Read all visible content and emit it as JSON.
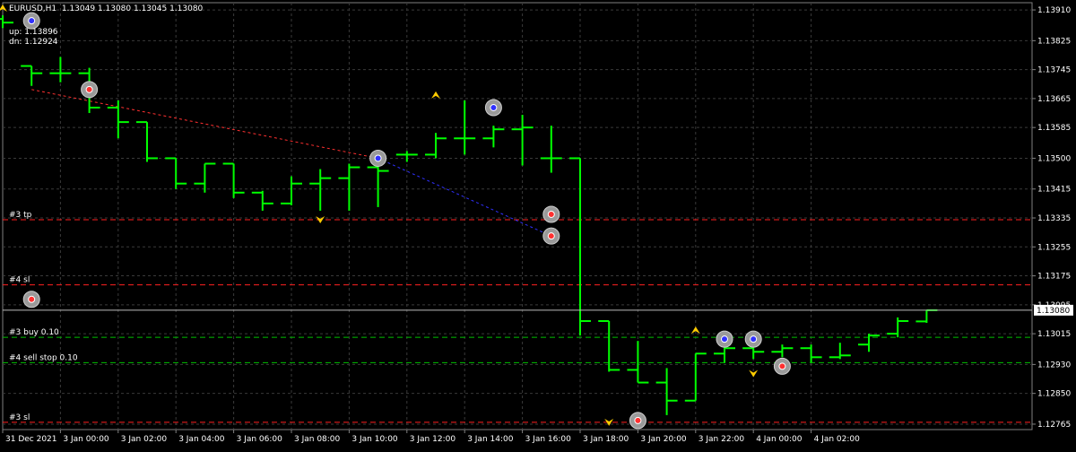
{
  "header": {
    "title": "EURUSD,H1  1.13049 1.13080 1.13045 1.13080",
    "up_label": "up: 1.13896",
    "dn_label": "dn: 1.12924"
  },
  "colors": {
    "background": "#000000",
    "grid": "#3a3a3a",
    "bar": "#00ff00",
    "axis_text": "#ffffff",
    "level_red": "#ff2020",
    "level_green": "#00c000",
    "trade_red": "#ff3030",
    "trade_blue": "#3030ff",
    "arrow_yellow": "#ffcc00"
  },
  "price_ticks": [
    "1.13910",
    "1.13825",
    "1.13745",
    "1.13665",
    "1.13585",
    "1.13500",
    "1.13415",
    "1.13335",
    "1.13255",
    "1.13175",
    "1.13095",
    "1.13015",
    "1.12930",
    "1.12850",
    "1.12765"
  ],
  "current_price_label": "1.13080",
  "time_ticks": [
    "31 Dec 2021",
    "3 Jan 00:00",
    "3 Jan 02:00",
    "3 Jan 04:00",
    "3 Jan 06:00",
    "3 Jan 08:00",
    "3 Jan 10:00",
    "3 Jan 12:00",
    "3 Jan 14:00",
    "3 Jan 16:00",
    "3 Jan 18:00",
    "3 Jan 20:00",
    "3 Jan 22:00",
    "4 Jan 00:00",
    "4 Jan 02:00"
  ],
  "levels": [
    {
      "label": "#3 tp",
      "price": 1.1333,
      "kind": "red"
    },
    {
      "label": "#4 sl",
      "price": 1.1315,
      "kind": "red"
    },
    {
      "label": "#3 buy 0.10",
      "price": 1.13005,
      "kind": "green"
    },
    {
      "label": "#4 sell stop 0.10",
      "price": 1.12935,
      "kind": "green"
    },
    {
      "label": "#3 sl",
      "price": 1.1277,
      "kind": "red"
    }
  ],
  "chart_data": {
    "type": "ohlc",
    "price_range": [
      1.1275,
      1.1393
    ],
    "grid": true,
    "bars": [
      {
        "o": 1.13885,
        "h": 1.13895,
        "l": 1.1386,
        "c": 1.13875
      },
      {
        "o": 1.13755,
        "h": 1.13755,
        "l": 1.137,
        "c": 1.13735
      },
      {
        "o": 1.13735,
        "h": 1.1378,
        "l": 1.1371,
        "c": 1.13735
      },
      {
        "o": 1.13735,
        "h": 1.1375,
        "l": 1.13625,
        "c": 1.1364
      },
      {
        "o": 1.1364,
        "h": 1.1366,
        "l": 1.13555,
        "c": 1.136
      },
      {
        "o": 1.136,
        "h": 1.136,
        "l": 1.1349,
        "c": 1.135
      },
      {
        "o": 1.135,
        "h": 1.135,
        "l": 1.13415,
        "c": 1.1343
      },
      {
        "o": 1.1343,
        "h": 1.13485,
        "l": 1.13405,
        "c": 1.13485
      },
      {
        "o": 1.13485,
        "h": 1.13485,
        "l": 1.1339,
        "c": 1.13405
      },
      {
        "o": 1.13405,
        "h": 1.1341,
        "l": 1.13355,
        "c": 1.13375
      },
      {
        "o": 1.13375,
        "h": 1.1345,
        "l": 1.1337,
        "c": 1.1343
      },
      {
        "o": 1.1343,
        "h": 1.1347,
        "l": 1.13355,
        "c": 1.13445
      },
      {
        "o": 1.13445,
        "h": 1.13485,
        "l": 1.13355,
        "c": 1.13475
      },
      {
        "o": 1.13475,
        "h": 1.1349,
        "l": 1.13365,
        "c": 1.13465
      },
      {
        "o": 1.1351,
        "h": 1.1352,
        "l": 1.1349,
        "c": 1.1351
      },
      {
        "o": 1.1351,
        "h": 1.1357,
        "l": 1.135,
        "c": 1.13555
      },
      {
        "o": 1.13555,
        "h": 1.1366,
        "l": 1.1351,
        "c": 1.13555
      },
      {
        "o": 1.13555,
        "h": 1.1359,
        "l": 1.1353,
        "c": 1.1358
      },
      {
        "o": 1.1358,
        "h": 1.1362,
        "l": 1.1348,
        "c": 1.13585
      },
      {
        "o": 1.135,
        "h": 1.1359,
        "l": 1.1346,
        "c": 1.135
      },
      {
        "o": 1.135,
        "h": 1.135,
        "l": 1.1301,
        "c": 1.1305
      },
      {
        "o": 1.1305,
        "h": 1.1305,
        "l": 1.1291,
        "c": 1.12915
      },
      {
        "o": 1.12915,
        "h": 1.12995,
        "l": 1.1288,
        "c": 1.1288
      },
      {
        "o": 1.1288,
        "h": 1.1292,
        "l": 1.1279,
        "c": 1.1283
      },
      {
        "o": 1.1283,
        "h": 1.1296,
        "l": 1.1283,
        "c": 1.1296
      },
      {
        "o": 1.1296,
        "h": 1.12985,
        "l": 1.12935,
        "c": 1.12975
      },
      {
        "o": 1.12975,
        "h": 1.12995,
        "l": 1.12945,
        "c": 1.12965
      },
      {
        "o": 1.12965,
        "h": 1.12985,
        "l": 1.1295,
        "c": 1.12975
      },
      {
        "o": 1.12975,
        "h": 1.12985,
        "l": 1.12935,
        "c": 1.1295
      },
      {
        "o": 1.1295,
        "h": 1.1299,
        "l": 1.12945,
        "c": 1.12955
      },
      {
        "o": 1.12985,
        "h": 1.13015,
        "l": 1.12965,
        "c": 1.1301
      },
      {
        "o": 1.13015,
        "h": 1.1306,
        "l": 1.13005,
        "c": 1.1305
      },
      {
        "o": 1.13049,
        "h": 1.1308,
        "l": 1.13045,
        "c": 1.1308
      }
    ],
    "trades": [
      {
        "open_bar": 1,
        "open_price": 1.1369,
        "close_bar": 13,
        "close_price": 1.135,
        "dir": "sell"
      },
      {
        "open_bar": 13,
        "open_price": 1.135,
        "close_bar": 19,
        "close_price": 1.13285,
        "dir": "buy"
      }
    ],
    "markers": [
      {
        "bar": 1,
        "price": 1.1388,
        "color": "blue"
      },
      {
        "bar": 3,
        "price": 1.1369,
        "color": "red"
      },
      {
        "bar": 1,
        "price": 1.1311,
        "color": "red"
      },
      {
        "bar": 13,
        "price": 1.135,
        "color": "blue"
      },
      {
        "bar": 17,
        "price": 1.1364,
        "color": "blue"
      },
      {
        "bar": 19,
        "price": 1.13345,
        "color": "red"
      },
      {
        "bar": 19,
        "price": 1.13285,
        "color": "red"
      },
      {
        "bar": 22,
        "price": 1.12775,
        "color": "red"
      },
      {
        "bar": 25,
        "price": 1.13,
        "color": "blue"
      },
      {
        "bar": 26,
        "price": 1.13,
        "color": "blue"
      },
      {
        "bar": 27,
        "price": 1.12925,
        "color": "red"
      }
    ],
    "arrows": [
      {
        "bar": 0,
        "price": 1.13915,
        "dir": "up"
      },
      {
        "bar": 11,
        "price": 1.1333,
        "dir": "down"
      },
      {
        "bar": 15,
        "price": 1.13675,
        "dir": "up"
      },
      {
        "bar": 21,
        "price": 1.1277,
        "dir": "down"
      },
      {
        "bar": 24,
        "price": 1.13025,
        "dir": "up"
      },
      {
        "bar": 26,
        "price": 1.12905,
        "dir": "down"
      }
    ]
  }
}
